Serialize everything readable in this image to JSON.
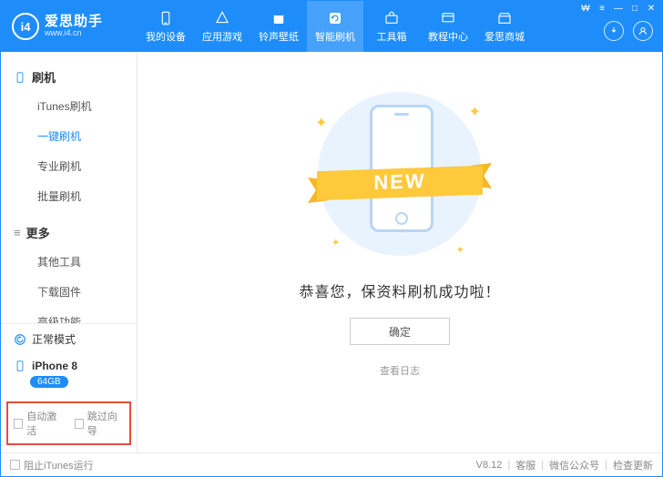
{
  "brand": {
    "title": "爱思助手",
    "subtitle": "www.i4.cn",
    "logo": "i4"
  },
  "nav": {
    "items": [
      {
        "key": "device",
        "label": "我的设备"
      },
      {
        "key": "apps",
        "label": "应用游戏"
      },
      {
        "key": "ring",
        "label": "铃声壁纸"
      },
      {
        "key": "flash",
        "label": "智能刷机"
      },
      {
        "key": "toolbox",
        "label": "工具箱"
      },
      {
        "key": "tutorial",
        "label": "教程中心"
      },
      {
        "key": "store",
        "label": "爱思商城"
      }
    ],
    "activeIndex": 3
  },
  "sidebar": {
    "groups": [
      {
        "title": "刷机",
        "icon": "phone",
        "items": [
          {
            "label": "iTunes刷机"
          },
          {
            "label": "一键刷机",
            "active": true
          },
          {
            "label": "专业刷机"
          },
          {
            "label": "批量刷机"
          }
        ]
      },
      {
        "title": "更多",
        "icon": "more",
        "items": [
          {
            "label": "其他工具"
          },
          {
            "label": "下载固件"
          },
          {
            "label": "高级功能"
          }
        ]
      }
    ],
    "mode": "正常模式",
    "device": {
      "name": "iPhone 8",
      "storage": "64GB"
    },
    "checks": {
      "auto_activate": "自动激活",
      "skip_guide": "跳过向导"
    }
  },
  "main": {
    "ribbon": "NEW",
    "message": "恭喜您，保资料刷机成功啦！",
    "ok": "确定",
    "log": "查看日志"
  },
  "footer": {
    "block_itunes": "阻止iTunes运行",
    "version": "V8.12",
    "support": "客服",
    "wechat": "微信公众号",
    "update": "检查更新"
  }
}
